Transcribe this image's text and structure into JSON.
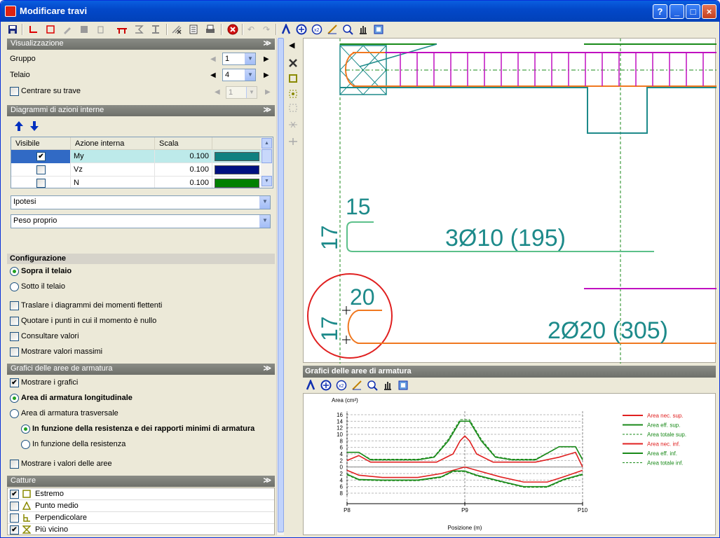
{
  "window": {
    "title": "Modificare travi",
    "help_btn": "?",
    "min_btn": "_",
    "max_btn": "□",
    "close_btn": "×"
  },
  "visualizzazione": {
    "title": "Visualizzazione",
    "gruppo_label": "Gruppo",
    "gruppo_value": "1",
    "telaio_label": "Telaio",
    "telaio_value": "4",
    "centrare_label": "Centrare su trave",
    "centrare_checked": false,
    "centrare_value": "1"
  },
  "diagrammi": {
    "title": "Diagrammi di azioni interne",
    "columns": [
      "Visibile",
      "Azione interna",
      "Scala",
      ""
    ],
    "rows": [
      {
        "visible": true,
        "azione": "My",
        "scala": "0.100",
        "color": "#0f8080"
      },
      {
        "visible": false,
        "azione": "Vz",
        "scala": "0.100",
        "color": "#001080"
      },
      {
        "visible": false,
        "azione": "N",
        "scala": "0.100",
        "color": "#008000"
      }
    ],
    "ipotesi_value": "Ipotesi",
    "caso_value": "Peso proprio"
  },
  "configurazione": {
    "title": "Configurazione",
    "options": [
      "Sopra il telaio",
      "Sotto il telaio"
    ],
    "selected": 0,
    "checks": [
      "Traslare i diagrammi dei momenti flettenti",
      "Quotare i punti in cui il momento è nullo",
      "Consultare valori",
      "Mostrare valori massimi"
    ]
  },
  "grafici_panel": {
    "title": "Grafici delle aree de armatura",
    "mostrare_grafici": "Mostrare i grafici",
    "area_long": "Area di armatura longitudinale",
    "area_trasv": "Area di armatura trasversale",
    "opt_resistenza_minimi": "In funzione della resistenza e dei rapporti minimi di armatura",
    "opt_resistenza": "In funzione della resistenza",
    "mostrare_valori": "Mostrare i valori delle aree"
  },
  "catture": {
    "title": "Catture",
    "items": [
      {
        "label": "Estremo",
        "checked": true
      },
      {
        "label": "Punto medio",
        "checked": false
      },
      {
        "label": "Perpendicolare",
        "checked": false
      },
      {
        "label": "Più vicino",
        "checked": true
      }
    ]
  },
  "drawing": {
    "top_dim_1": "15",
    "side_dim_1": "17",
    "label_1": "3Ø10 (195)",
    "top_dim_2": "20",
    "side_dim_2": "17",
    "label_2": "2Ø20 (305)",
    "color_teal": "#1d8a8a",
    "color_orange": "#f07820",
    "color_magenta": "#c010c0",
    "color_green": "#1a8a1a",
    "color_red": "#e02020"
  },
  "chart_panel_title": "Grafici delle aree di armatura",
  "chart_data": {
    "type": "line",
    "ylabel": "Area (cm²)",
    "xlabel": "Posizione (m)",
    "x_ticks": [
      "P8",
      "P9",
      "P10"
    ],
    "y_ticks_top": [
      16,
      14,
      12,
      10,
      8,
      6,
      4,
      2,
      0
    ],
    "y_ticks_bottom": [
      2,
      4,
      6,
      8
    ],
    "grid": true,
    "legend_position": "right",
    "legend": [
      {
        "name": "Area nec. sup.",
        "color": "#e02020",
        "style": "solid"
      },
      {
        "name": "Area eff. sup.",
        "color": "#1a8a1a",
        "style": "solid"
      },
      {
        "name": "Area totale sup.",
        "color": "#1a8a1a",
        "style": "dashed"
      },
      {
        "name": "Area nec. inf.",
        "color": "#e02020",
        "style": "solid"
      },
      {
        "name": "Area eff. inf.",
        "color": "#1a8a1a",
        "style": "solid"
      },
      {
        "name": "Area totale inf.",
        "color": "#1a8a1a",
        "style": "dashed"
      }
    ],
    "series": [
      {
        "name": "Area nec. sup.",
        "x": [
          0,
          0.05,
          0.1,
          0.2,
          0.3,
          0.38,
          0.45,
          0.48,
          0.5,
          0.52,
          0.55,
          0.62,
          0.7,
          0.8,
          0.9,
          0.97,
          1.0
        ],
        "y": [
          2,
          3.5,
          1.5,
          1.5,
          1.5,
          1.5,
          4,
          8,
          9.5,
          8,
          4,
          1.5,
          1.5,
          1.5,
          3,
          4.5,
          0
        ]
      },
      {
        "name": "Area eff. sup.",
        "x": [
          0,
          0.05,
          0.1,
          0.2,
          0.3,
          0.37,
          0.43,
          0.48,
          0.5,
          0.52,
          0.57,
          0.63,
          0.7,
          0.8,
          0.9,
          0.97,
          1.0
        ],
        "y": [
          4.5,
          4.5,
          2.2,
          2.2,
          2.2,
          3,
          8,
          14,
          14,
          14,
          8,
          3,
          2.2,
          2.2,
          6.2,
          6.2,
          2.2
        ]
      },
      {
        "name": "Area totale sup.",
        "x": [
          0,
          0.05,
          0.1,
          0.2,
          0.3,
          0.37,
          0.43,
          0.48,
          0.5,
          0.52,
          0.57,
          0.63,
          0.7,
          0.8,
          0.9,
          0.97,
          1.0
        ],
        "y": [
          4.5,
          4.5,
          2.4,
          2.4,
          2.4,
          3.2,
          8.5,
          14.5,
          14.5,
          14.5,
          8.5,
          3.2,
          2.4,
          2.4,
          6.2,
          6.2,
          2.4
        ]
      },
      {
        "name": "Area nec. inf.",
        "x": [
          0,
          0.05,
          0.15,
          0.3,
          0.4,
          0.45,
          0.5,
          0.55,
          0.65,
          0.75,
          0.85,
          0.92,
          1.0
        ],
        "y": [
          -1,
          -2.5,
          -3.2,
          -3.2,
          -2,
          -1,
          0,
          -1,
          -3,
          -4.6,
          -4.6,
          -3,
          -1
        ]
      },
      {
        "name": "Area eff. inf.",
        "x": [
          0,
          0.05,
          0.15,
          0.3,
          0.4,
          0.45,
          0.5,
          0.55,
          0.65,
          0.75,
          0.85,
          0.92,
          1.0
        ],
        "y": [
          -2.2,
          -3.8,
          -4,
          -4,
          -3,
          -1.2,
          -1.2,
          -2.5,
          -4.3,
          -6,
          -6,
          -3.8,
          -2.2
        ]
      },
      {
        "name": "Area totale inf.",
        "x": [
          0,
          0.05,
          0.15,
          0.3,
          0.4,
          0.45,
          0.5,
          0.55,
          0.65,
          0.75,
          0.85,
          0.92,
          1.0
        ],
        "y": [
          -2.4,
          -4,
          -4.2,
          -4.2,
          -3.2,
          -1.4,
          -1.4,
          -2.7,
          -4.5,
          -6.2,
          -6.2,
          -4,
          -2.4
        ]
      }
    ],
    "ylim": [
      -8,
      16
    ]
  }
}
